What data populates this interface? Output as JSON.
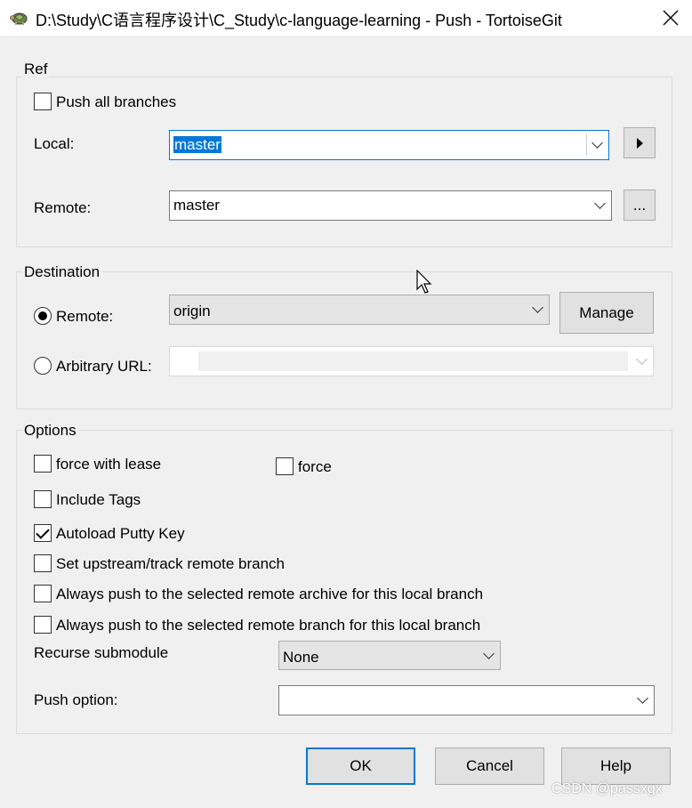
{
  "window": {
    "title": "D:\\Study\\C语言程序设计\\C_Study\\c-language-learning - Push - TortoiseGit",
    "app_icon": "tortoise-icon",
    "close_icon": "close-icon"
  },
  "ref": {
    "group_label": "Ref",
    "push_all_branches": {
      "label": "Push all branches",
      "checked": false
    },
    "local_label": "Local:",
    "local_value": "master",
    "remote_label": "Remote:",
    "remote_value": "master",
    "browse_label": "..."
  },
  "destination": {
    "group_label": "Destination",
    "remote_radio": {
      "label": "Remote:",
      "checked": true
    },
    "remote_value": "origin",
    "manage_label": "Manage",
    "url_radio": {
      "label": "Arbitrary URL:",
      "checked": false
    },
    "url_value": ""
  },
  "options": {
    "group_label": "Options",
    "force_with_lease": {
      "label": "force with lease",
      "checked": false
    },
    "force": {
      "label": "force",
      "checked": false
    },
    "include_tags": {
      "label": "Include Tags",
      "checked": false
    },
    "autoload_putty": {
      "label": "Autoload Putty Key",
      "checked": true
    },
    "set_upstream": {
      "label": "Set upstream/track remote branch",
      "checked": false
    },
    "always_push_archive": {
      "label": "Always push to the selected remote archive for this local branch",
      "checked": false
    },
    "always_push_branch": {
      "label": "Always push to the selected remote branch for this local branch",
      "checked": false
    },
    "recurse_label": "Recurse submodule",
    "recurse_value": "None",
    "push_option_label": "Push option:",
    "push_option_value": ""
  },
  "buttons": {
    "ok": "OK",
    "cancel": "Cancel",
    "help": "Help"
  },
  "watermark": "CSDN @passxgx",
  "colors": {
    "accent": "#0078d7",
    "background": "#f0f0f0"
  }
}
